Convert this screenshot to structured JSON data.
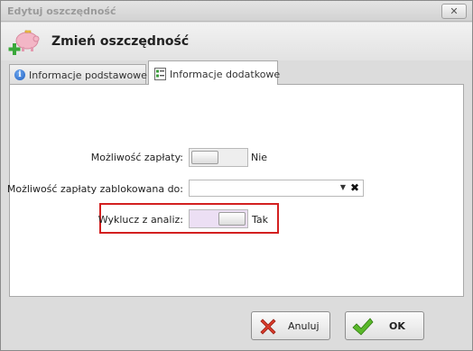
{
  "window": {
    "title": "Edytuj oszczędność",
    "close_glyph": "✕"
  },
  "header": {
    "title": "Zmień oszczędność",
    "icon": "piggy-bank-add-icon"
  },
  "tabs": [
    {
      "label": "Informacje podstawowe",
      "icon": "info-icon",
      "active": false
    },
    {
      "label": "Informacje dodatkowe",
      "icon": "form-icon",
      "active": true
    }
  ],
  "form": {
    "payment_possible": {
      "label": "Możliwość zapłaty:",
      "state": "Nie",
      "value": false
    },
    "payment_blocked_until": {
      "label": "Możliwość zapłaty zablokowana do:",
      "value": ""
    },
    "exclude_from_analysis": {
      "label": "Wyklucz z analiz:",
      "state": "Tak",
      "value": true
    }
  },
  "buttons": {
    "cancel": "Anuluj",
    "ok": "OK"
  },
  "colors": {
    "highlight_border": "#d32020",
    "toggle_on_background": "#ecdff4",
    "ok_check": "#5ab82a",
    "cancel_x": "#d93a2a"
  }
}
